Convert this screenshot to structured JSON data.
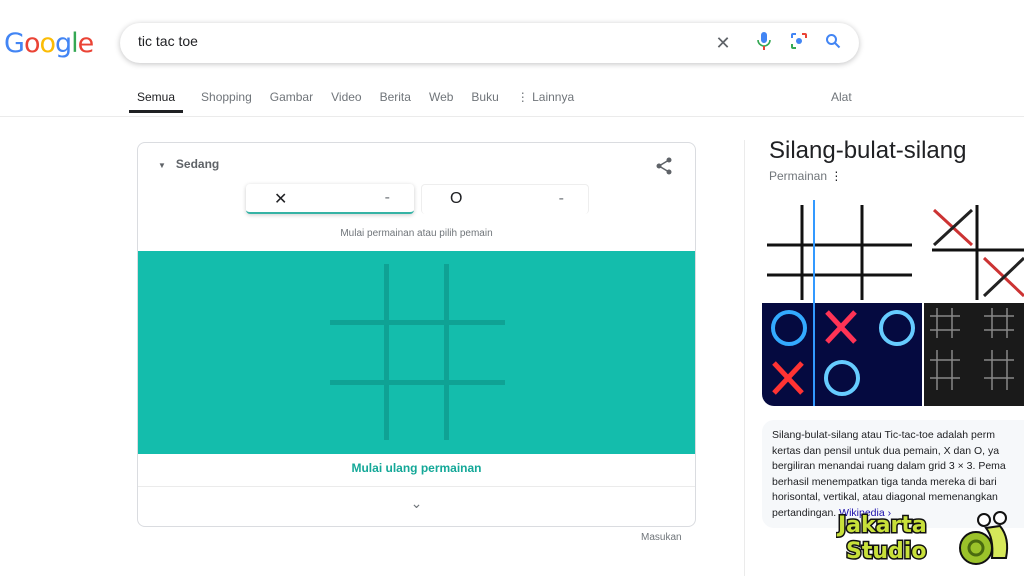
{
  "header": {
    "logo": "Google",
    "search_value": "tic tac toe",
    "icons": [
      "clear-icon",
      "mic-icon",
      "lens-icon",
      "search-icon"
    ]
  },
  "tabs": [
    {
      "label": "Semua",
      "active": true
    },
    {
      "label": "Shopping"
    },
    {
      "label": "Gambar"
    },
    {
      "label": "Video"
    },
    {
      "label": "Berita"
    },
    {
      "label": "Web"
    },
    {
      "label": "Buku"
    },
    {
      "label": "⋮ Lainnya"
    }
  ],
  "tools_label": "Alat",
  "game": {
    "difficulty": "Sedang",
    "players": [
      {
        "symbol": "✕",
        "score": "-"
      },
      {
        "symbol": "O",
        "score": "-"
      }
    ],
    "hint": "Mulai permainan atau pilih pemain",
    "restart": "Mulai ulang permainan",
    "board_color": "#14bdac",
    "accent": "#36b3a5"
  },
  "feedback": "Masukan",
  "knowledge_panel": {
    "title": "Silang-bulat-silang",
    "subtitle": "Permainan",
    "description_lines": [
      "Silang-bulat-silang atau Tic-tac-toe adalah perm",
      "kertas dan pensil untuk dua pemain, X dan O, ya",
      "bergiliran menandai ruang dalam grid 3 × 3. Pema",
      "berhasil menempatkan tiga tanda mereka di bari",
      "horisontal, vertikal, atau diagonal memenangkan",
      "pertandingan."
    ],
    "source_link": "Wikipedia ›"
  },
  "watermark": {
    "line1": "Jakarta",
    "line2": "Studio"
  }
}
